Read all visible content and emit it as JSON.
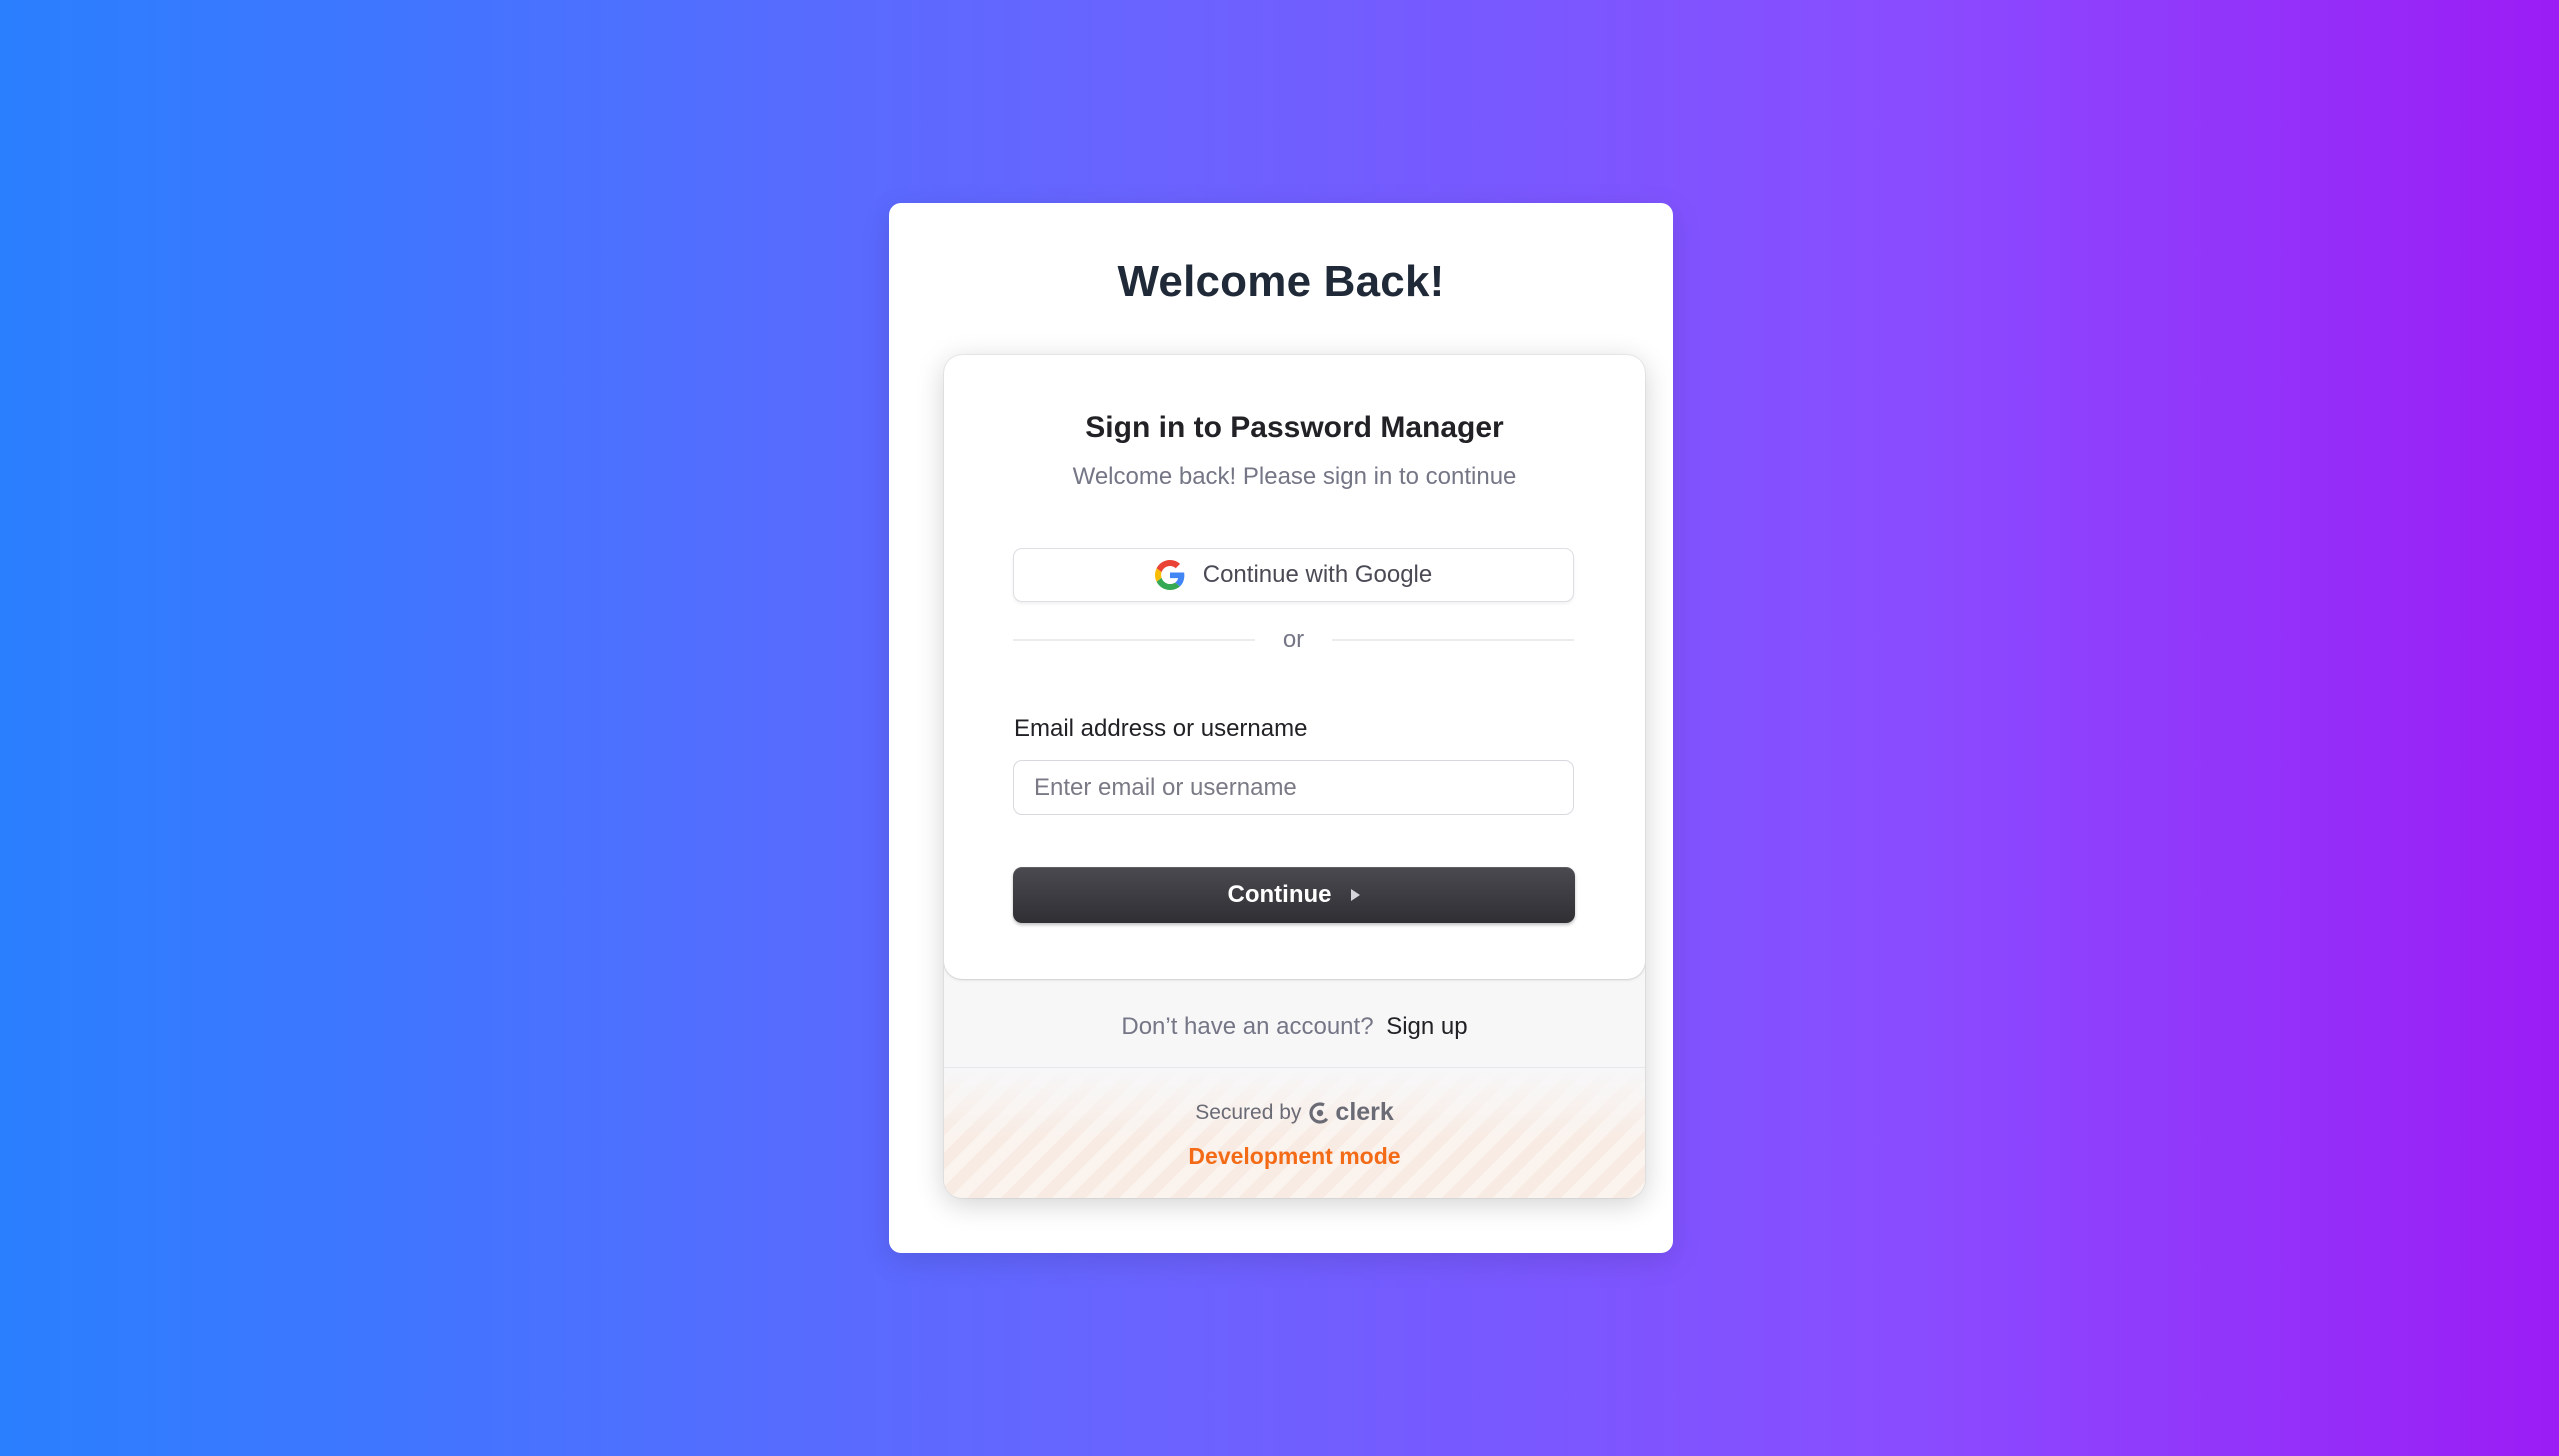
{
  "page": {
    "heading": "Welcome Back!"
  },
  "signin": {
    "title": "Sign in to Password Manager",
    "subtitle": "Welcome back! Please sign in to continue",
    "google_button": {
      "label": "Continue with Google",
      "icon": "google-icon"
    },
    "divider_text": "or",
    "identifier": {
      "label": "Email address or username",
      "placeholder": "Enter email or username",
      "value": ""
    },
    "continue_button": {
      "label": "Continue",
      "icon": "triangle-right-icon"
    },
    "signup": {
      "prompt": "Don’t have an account?",
      "link": "Sign up"
    },
    "footer": {
      "secured_by": "Secured by",
      "brand": "clerk",
      "dev_mode": "Development mode"
    }
  },
  "colors": {
    "gradient_start": "#2a7fff",
    "gradient_end": "#9b1cf5",
    "button_dark": "#2f2f34",
    "dev_mode": "#f36b16"
  }
}
